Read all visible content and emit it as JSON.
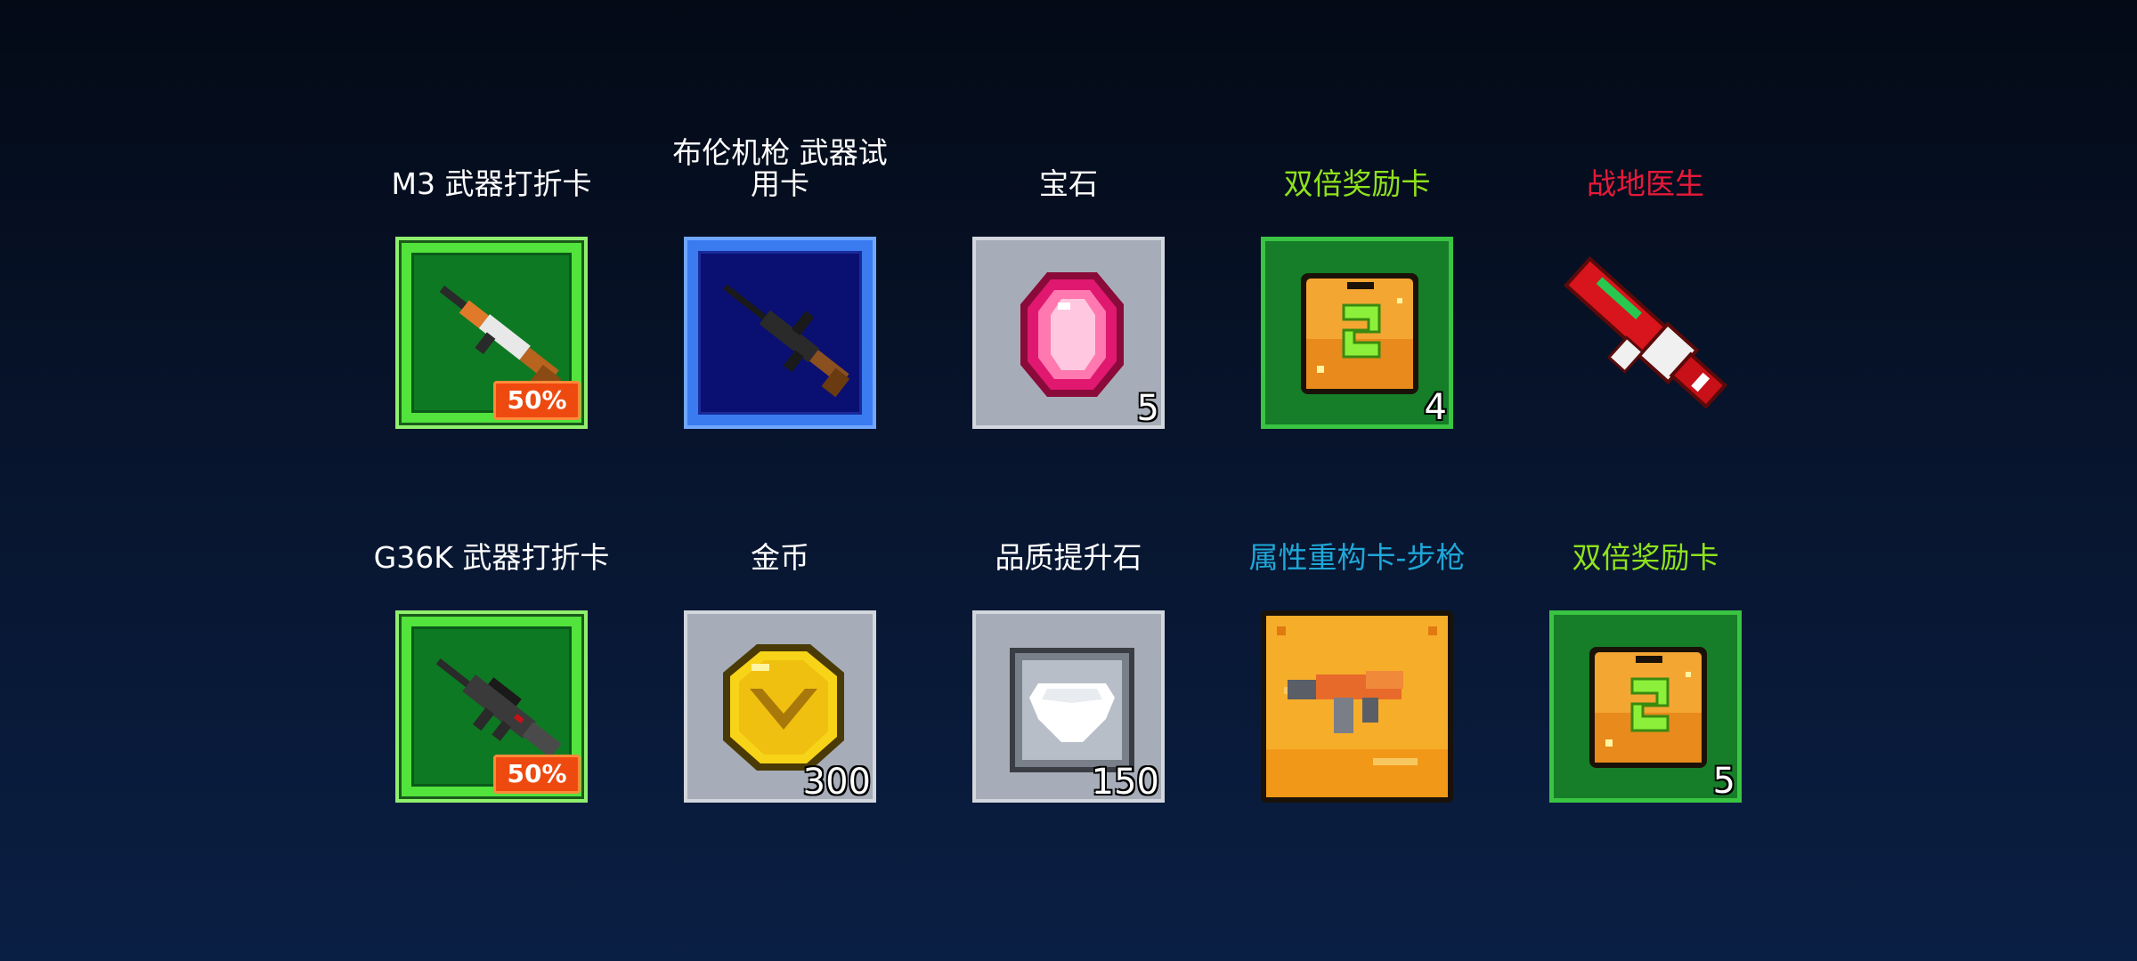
{
  "colors": {
    "white": "#ffffff",
    "lime": "#8fe21c",
    "red": "#e8193a",
    "cyan": "#1fa7d8"
  },
  "rows": [
    [
      {
        "title": "M3 武器打折卡",
        "color": "#ffffff",
        "icon": "m3-rifle-icon",
        "badge": "50%"
      },
      {
        "title": "布伦机枪 武器试用卡",
        "color": "#ffffff",
        "icon": "bren-gun-icon"
      },
      {
        "title": "宝石",
        "color": "#ffffff",
        "icon": "pink-gem-icon",
        "count": "5"
      },
      {
        "title": "双倍奖励卡",
        "color": "#8fe21c",
        "icon": "double-reward-card-icon",
        "count": "4"
      },
      {
        "title": "战地医生",
        "color": "#e8193a",
        "icon": "field-medic-gun-icon"
      }
    ],
    [
      {
        "title": "G36K 武器打折卡",
        "color": "#ffffff",
        "icon": "g36k-rifle-icon",
        "badge": "50%"
      },
      {
        "title": "金币",
        "color": "#ffffff",
        "icon": "gold-coin-icon",
        "count": "300"
      },
      {
        "title": "品质提升石",
        "color": "#ffffff",
        "icon": "quality-stone-icon",
        "count": "150"
      },
      {
        "title": "属性重构卡-步枪",
        "color": "#1fa7d8",
        "icon": "rifle-reforge-card-icon"
      },
      {
        "title": "双倍奖励卡",
        "color": "#8fe21c",
        "icon": "double-reward-card-icon",
        "count": "5"
      }
    ]
  ]
}
